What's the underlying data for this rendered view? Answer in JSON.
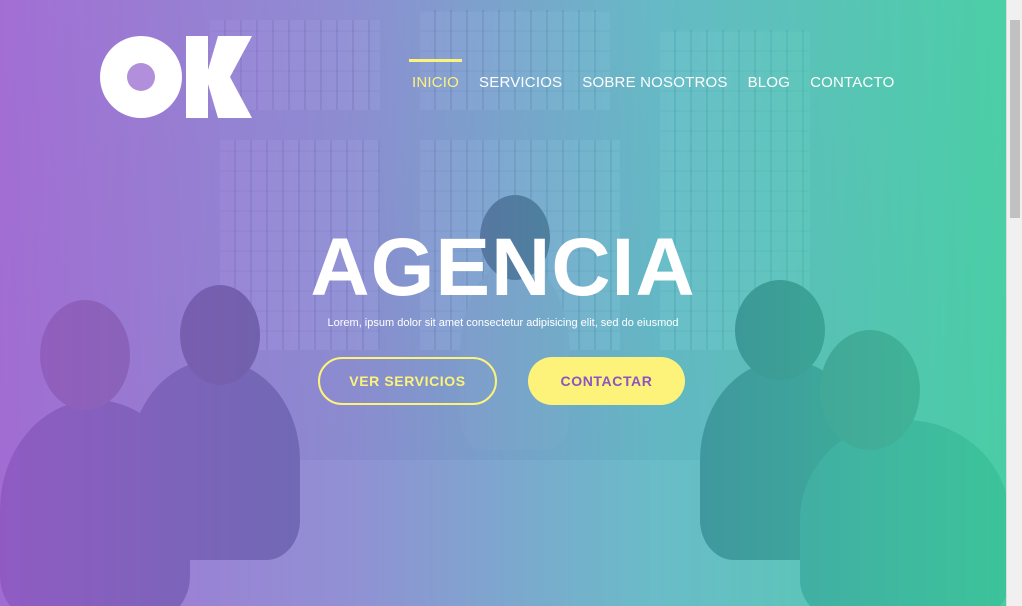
{
  "brand": {
    "logo_text": "OK",
    "logo_color": "#ffffff"
  },
  "nav": {
    "items": [
      {
        "label": "INICIO",
        "active": true
      },
      {
        "label": "SERVICIOS",
        "active": false
      },
      {
        "label": "SOBRE NOSOTROS",
        "active": false
      },
      {
        "label": "BLOG",
        "active": false
      },
      {
        "label": "CONTACTO",
        "active": false
      }
    ]
  },
  "hero": {
    "title": "AGENCIA",
    "subtitle": "Lorem, ipsum dolor sit amet consectetur adipisicing elit, sed do eiusmod",
    "primary_button": "VER SERVICIOS",
    "secondary_button": "CONTACTAR"
  },
  "colors": {
    "accent": "#fdf37a",
    "overlay_left": "#9b5fd2",
    "overlay_right": "#3ccda0",
    "button_text": "#8a55c2"
  }
}
